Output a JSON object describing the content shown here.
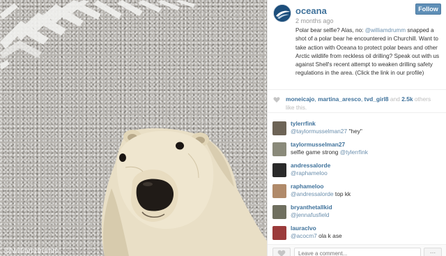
{
  "post": {
    "username": "oceana",
    "time_ago": "2 months ago",
    "follow_label": "Follow",
    "caption": {
      "before_mention": "Polar bear selfie? Alas, no: ",
      "mention": "@williamdrumm",
      "after_mention": " snapped a shot of a polar bear he encountered in Churchill. Want to take action with Oceana to protect polar bears and other Arctic wildlife from reckless oil drilling? Speak out with us against Shell's recent attempt to weaken drilling safety regulations in the area. (Click the link in our profile)"
    },
    "photo_watermark": "@williamdrumm"
  },
  "likes": {
    "likers": [
      "moneicajo",
      "martina_aresco",
      "tvd_girl8"
    ],
    "separator": ", ",
    "and_text": " and ",
    "count": "2.5k",
    "others_text": " others like this."
  },
  "comments": [
    {
      "user": "tylerrfink",
      "mention": "@taylormusselman27",
      "text": " \"hey\"",
      "avatar_color": "#6d6456"
    },
    {
      "user": "taylormusselman27",
      "mention": "",
      "text": "selfie game strong ",
      "mention_after": "@tylerrfink",
      "avatar_color": "#8a8a7a"
    },
    {
      "user": "andressalorde",
      "mention": "@raphameloo",
      "text": "",
      "avatar_color": "#2a2a2a"
    },
    {
      "user": "raphameloo",
      "mention": "@andressalorde",
      "text": " top kk",
      "avatar_color": "#b08a6a"
    },
    {
      "user": "bryanthetallkid",
      "mention": "@jennafusfield",
      "text": "",
      "avatar_color": "#6f6f5f"
    },
    {
      "user": "lauraclvo",
      "mention": "@acocm7",
      "text": " ola k ase",
      "avatar_color": "#9b3b3b"
    }
  ],
  "footer": {
    "comment_placeholder": "Leave a comment...",
    "more_label": "..."
  },
  "icons": {
    "heart": "heart-icon",
    "like_button": "heart-icon",
    "more": "ellipsis-icon"
  },
  "colors": {
    "brand_link": "#3f729b",
    "follow_button": "#5f8fb7",
    "avatar_bg": "#1d4f7c"
  }
}
